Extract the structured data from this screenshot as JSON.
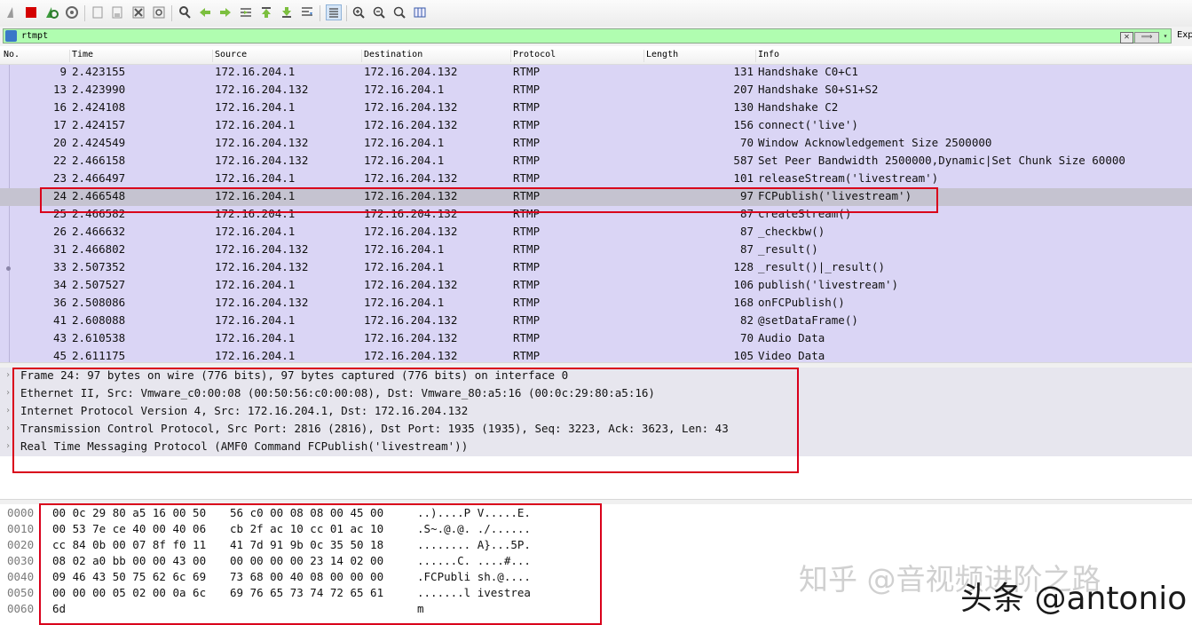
{
  "toolbar": {
    "buttons": [
      "shark-fin-start-icon",
      "stop-capture-icon",
      "restart-capture-icon",
      "capture-options-icon",
      "open-file-icon",
      "save-file-icon",
      "close-file-icon",
      "reload-file-icon",
      "find-packet-icon",
      "go-back-icon",
      "go-forward-icon",
      "go-to-packet-icon",
      "go-first-packet-icon",
      "go-last-packet-icon",
      "autoscroll-icon",
      "colorize-icon",
      "zoom-in-icon",
      "zoom-out-icon",
      "normal-size-icon",
      "resize-columns-icon"
    ]
  },
  "filter": {
    "value": "rtmpt",
    "clear_symbol": "✕",
    "apply_symbol": "⟹",
    "dropdown_symbol": "▾",
    "expression_label": "Exp"
  },
  "columns": [
    "No.",
    "Time",
    "Source",
    "Destination",
    "Protocol",
    "Length",
    "Info"
  ],
  "packets": [
    {
      "no": "9",
      "time": "2.423155",
      "src": "172.16.204.1",
      "dst": "172.16.204.132",
      "proto": "RTMP",
      "len": "131",
      "info": "Handshake C0+C1"
    },
    {
      "no": "13",
      "time": "2.423990",
      "src": "172.16.204.132",
      "dst": "172.16.204.1",
      "proto": "RTMP",
      "len": "207",
      "info": "Handshake S0+S1+S2"
    },
    {
      "no": "16",
      "time": "2.424108",
      "src": "172.16.204.1",
      "dst": "172.16.204.132",
      "proto": "RTMP",
      "len": "130",
      "info": "Handshake C2"
    },
    {
      "no": "17",
      "time": "2.424157",
      "src": "172.16.204.1",
      "dst": "172.16.204.132",
      "proto": "RTMP",
      "len": "156",
      "info": "connect('live')"
    },
    {
      "no": "20",
      "time": "2.424549",
      "src": "172.16.204.132",
      "dst": "172.16.204.1",
      "proto": "RTMP",
      "len": "70",
      "info": "Window Acknowledgement Size 2500000"
    },
    {
      "no": "22",
      "time": "2.466158",
      "src": "172.16.204.132",
      "dst": "172.16.204.1",
      "proto": "RTMP",
      "len": "587",
      "info": "Set Peer Bandwidth 2500000,Dynamic|Set Chunk Size 60000"
    },
    {
      "no": "23",
      "time": "2.466497",
      "src": "172.16.204.1",
      "dst": "172.16.204.132",
      "proto": "RTMP",
      "len": "101",
      "info": "releaseStream('livestream')"
    },
    {
      "no": "24",
      "time": "2.466548",
      "src": "172.16.204.1",
      "dst": "172.16.204.132",
      "proto": "RTMP",
      "len": "97",
      "info": "FCPublish('livestream')",
      "selected": true
    },
    {
      "no": "25",
      "time": "2.466582",
      "src": "172.16.204.1",
      "dst": "172.16.204.132",
      "proto": "RTMP",
      "len": "87",
      "info": "createStream()"
    },
    {
      "no": "26",
      "time": "2.466632",
      "src": "172.16.204.1",
      "dst": "172.16.204.132",
      "proto": "RTMP",
      "len": "87",
      "info": "_checkbw()"
    },
    {
      "no": "31",
      "time": "2.466802",
      "src": "172.16.204.132",
      "dst": "172.16.204.1",
      "proto": "RTMP",
      "len": "87",
      "info": "_result()"
    },
    {
      "no": "33",
      "time": "2.507352",
      "src": "172.16.204.132",
      "dst": "172.16.204.1",
      "proto": "RTMP",
      "len": "128",
      "info": "_result()|_result()"
    },
    {
      "no": "34",
      "time": "2.507527",
      "src": "172.16.204.1",
      "dst": "172.16.204.132",
      "proto": "RTMP",
      "len": "106",
      "info": "publish('livestream')"
    },
    {
      "no": "36",
      "time": "2.508086",
      "src": "172.16.204.132",
      "dst": "172.16.204.1",
      "proto": "RTMP",
      "len": "168",
      "info": "onFCPublish()"
    },
    {
      "no": "41",
      "time": "2.608088",
      "src": "172.16.204.1",
      "dst": "172.16.204.132",
      "proto": "RTMP",
      "len": "82",
      "info": "@setDataFrame()"
    },
    {
      "no": "43",
      "time": "2.610538",
      "src": "172.16.204.1",
      "dst": "172.16.204.132",
      "proto": "RTMP",
      "len": "70",
      "info": "Audio Data"
    },
    {
      "no": "45",
      "time": "2.611175",
      "src": "172.16.204.1",
      "dst": "172.16.204.132",
      "proto": "RTMP",
      "len": "105",
      "info": "Video Data"
    }
  ],
  "details": [
    "Frame 24: 97 bytes on wire (776 bits), 97 bytes captured (776 bits) on interface 0",
    "Ethernet II, Src: Vmware_c0:00:08 (00:50:56:c0:00:08), Dst: Vmware_80:a5:16 (00:0c:29:80:a5:16)",
    "Internet Protocol Version 4, Src: 172.16.204.1, Dst: 172.16.204.132",
    "Transmission Control Protocol, Src Port: 2816 (2816), Dst Port: 1935 (1935), Seq: 3223, Ack: 3623, Len: 43",
    "Real Time Messaging Protocol (AMF0 Command FCPublish('livestream'))"
  ],
  "detail_arrow": "›",
  "bytes": [
    {
      "offset": "0000",
      "hex1": "00 0c 29 80 a5 16 00 50",
      "hex2": "56 c0 00 08 08 00 45 00",
      "ascii": "..)....P V.....E."
    },
    {
      "offset": "0010",
      "hex1": "00 53 7e ce 40 00 40 06",
      "hex2": "cb 2f ac 10 cc 01 ac 10",
      "ascii": ".S~.@.@. ./......"
    },
    {
      "offset": "0020",
      "hex1": "cc 84 0b 00 07 8f f0 11",
      "hex2": "41 7d 91 9b 0c 35 50 18",
      "ascii": "........ A}...5P."
    },
    {
      "offset": "0030",
      "hex1": "08 02 a0 bb 00 00 43 00",
      "hex2": "00 00 00 00 23 14 02 00",
      "ascii": "......C. ....#..."
    },
    {
      "offset": "0040",
      "hex1": "09 46 43 50 75 62 6c 69",
      "hex2": "73 68 00 40 08 00 00 00",
      "ascii": ".FCPubli sh.@...."
    },
    {
      "offset": "0050",
      "hex1": "00 00 00 05 02 00 0a 6c",
      "hex2": "69 76 65 73 74 72 65 61",
      "ascii": ".......l ivestrea"
    },
    {
      "offset": "0060",
      "hex1": "6d",
      "hex2": "",
      "ascii": "m"
    }
  ],
  "watermarks": {
    "zhihu": "知乎 @音视频进阶之路",
    "toutiao": "头条 @antonio"
  },
  "colors": {
    "packet_row_bg": "#dad5f5",
    "selected_row_bg": "#c5c3d0",
    "filter_valid_bg": "#b0fdb0",
    "highlight_box": "#d9001b"
  }
}
